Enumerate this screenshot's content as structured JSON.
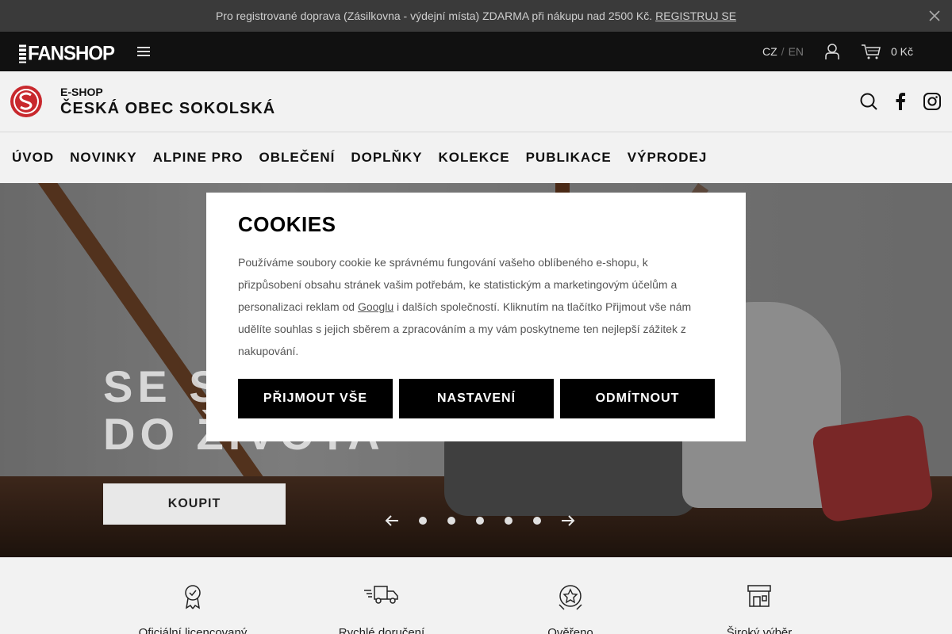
{
  "announcement": {
    "text": "Pro registrované doprava (Zásilkovna - výdejní místa) ZDARMA při nákupu nad 2500 Kč.",
    "link": "REGISTRUJ SE",
    "close_icon": "close-icon"
  },
  "topbar": {
    "logo": "FANSHOP",
    "lang_cz": "CZ",
    "lang_sep": "/",
    "lang_en": "EN",
    "cart_total": "0 Kč"
  },
  "brand": {
    "eshop_label": "E-SHOP",
    "name": "ČESKÁ OBEC SOKOLSKÁ"
  },
  "nav": {
    "items": [
      "ÚVOD",
      "NOVINKY",
      "ALPINE PRO",
      "OBLEČENÍ",
      "DOPLŇKY",
      "KOLEKCE",
      "PUBLIKACE",
      "VÝPRODEJ"
    ]
  },
  "hero": {
    "title_line1": "SE S",
    "title_line2": "DO ŽIVOTA",
    "cta": "KOUPIT"
  },
  "features": {
    "items": [
      "Oficiální licencovaný",
      "Rychlé doručení",
      "Ověřeno",
      "Široký výběr"
    ]
  },
  "cookies": {
    "title": "COOKIES",
    "text_before": "Používáme soubory cookie ke správnému fungování vašeho oblíbeného e-shopu, k přizpůsobení obsahu stránek vašim potřebám, ke statistickým a marketingovým účelům a personalizaci reklam od",
    "link": "Googlu",
    "text_after": "i dalších společností. Kliknutím na tlačítko Přijmout vše nám udělíte souhlas s jejich sběrem a zpracováním a my vám poskytneme ten nejlepší zážitek z nakupování.",
    "accept": "PŘIJMOUT VŠE",
    "settings": "NASTAVENÍ",
    "reject": "ODMÍTNOUT"
  },
  "colors": {
    "announcement_bg": "#3a3a3a",
    "topbar_bg": "#111111",
    "brand_red": "#c8282d",
    "button_black": "#000000"
  }
}
